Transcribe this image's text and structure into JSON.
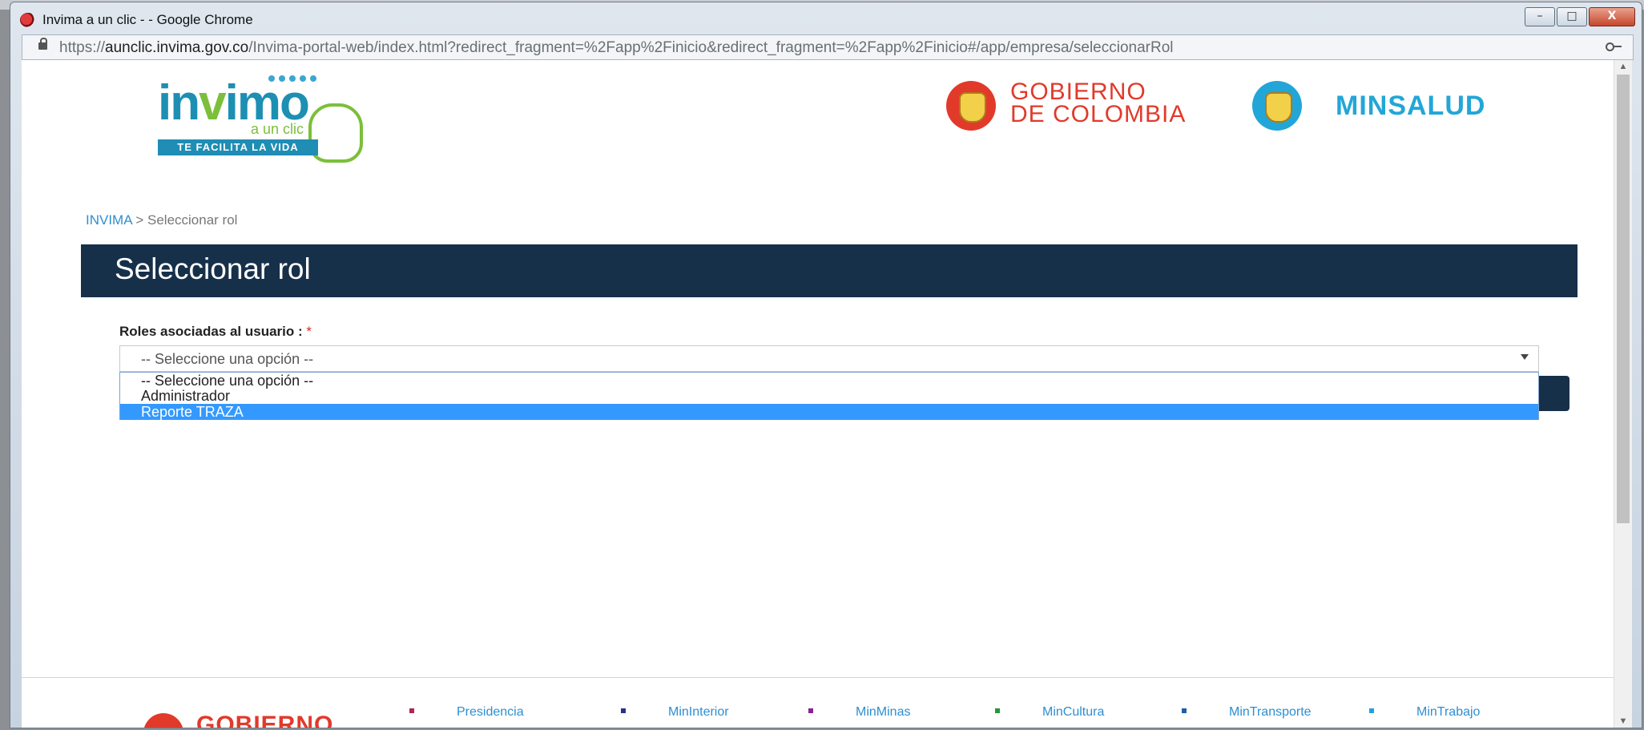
{
  "window": {
    "title": "Invima a un clic - - Google Chrome",
    "minimize_glyph": "–",
    "maximize_glyph": "□",
    "close_glyph": "X"
  },
  "address_bar": {
    "url_scheme": "https://",
    "url_host": "aunclic.invima.gov.co",
    "url_path": "/Invima-portal-web/index.html?redirect_fragment=%2Fapp%2Finicio&redirect_fragment=%2Fapp%2Finicio#/app/empresa/seleccionarRol"
  },
  "header": {
    "logo_word_a": "in",
    "logo_word_b": "v",
    "logo_word_c": "imo",
    "logo_sub": "a un clic",
    "logo_tagline": "TE FACILITA LA VIDA",
    "gobierno_line1": "GOBIERNO",
    "gobierno_line2": "DE COLOMBIA",
    "minsalud": "MINSALUD"
  },
  "breadcrumb": {
    "root": "INVIMA",
    "separator": " > ",
    "current": "Seleccionar rol"
  },
  "page": {
    "title": "Seleccionar rol"
  },
  "form": {
    "roles_label": "Roles asociadas al usuario :",
    "required_mark": "*",
    "select_value": "-- Seleccione una opción --",
    "options": [
      "-- Seleccione una opción --",
      "Administrador",
      "Reporte TRAZA"
    ],
    "highlighted_option_index": 2
  },
  "footer": {
    "gobierno": "GOBIERNO",
    "links": [
      {
        "label": "Presidencia",
        "color": "#b0245a"
      },
      {
        "label": "MinInterior",
        "color": "#2c2f8f"
      },
      {
        "label": "MinMinas",
        "color": "#8a2290"
      },
      {
        "label": "MinCultura",
        "color": "#1e9a3a"
      },
      {
        "label": "MinTransporte",
        "color": "#1d5fa8"
      },
      {
        "label": "MinTrabajo",
        "color": "#1fa3e0"
      }
    ]
  },
  "colors": {
    "title_bar": "#17304a",
    "link": "#2d8fd1",
    "gobierno_red": "#e13a2b",
    "minsalud_blue": "#22a6d8",
    "selected_option": "#3399ff"
  }
}
